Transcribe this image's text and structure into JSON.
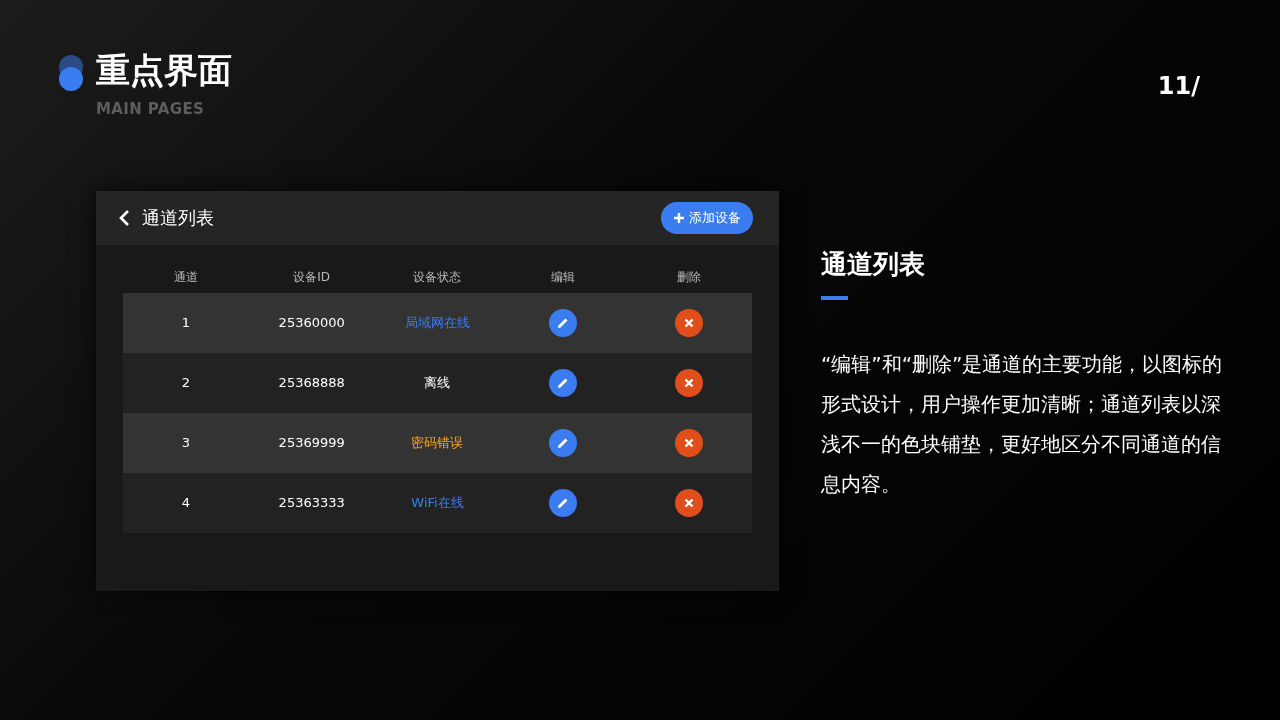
{
  "header": {
    "title": "重点界面",
    "subtitle": "MAIN PAGES",
    "page_number": "11/"
  },
  "app": {
    "title": "通道列表",
    "add_button": "添加设备",
    "columns": [
      "通道",
      "设备ID",
      "设备状态",
      "编辑",
      "删除"
    ],
    "rows": [
      {
        "channel": "1",
        "device_id": "25360000",
        "status": "局域网在线",
        "color": "#3b7cf0"
      },
      {
        "channel": "2",
        "device_id": "25368888",
        "status": "离线",
        "color": "#ffffff"
      },
      {
        "channel": "3",
        "device_id": "25369999",
        "status": "密码错误",
        "color": "#f5a623"
      },
      {
        "channel": "4",
        "device_id": "25363333",
        "status": "WiFi在线",
        "color": "#3b7cf0"
      }
    ]
  },
  "description": {
    "title": "通道列表",
    "text": "“编辑”和“删除”是通道的主要功能，以图标的形式设计，用户操作更加清晰；通道列表以深浅不一的色块铺垫，更好地区分不同通道的信息内容。"
  }
}
